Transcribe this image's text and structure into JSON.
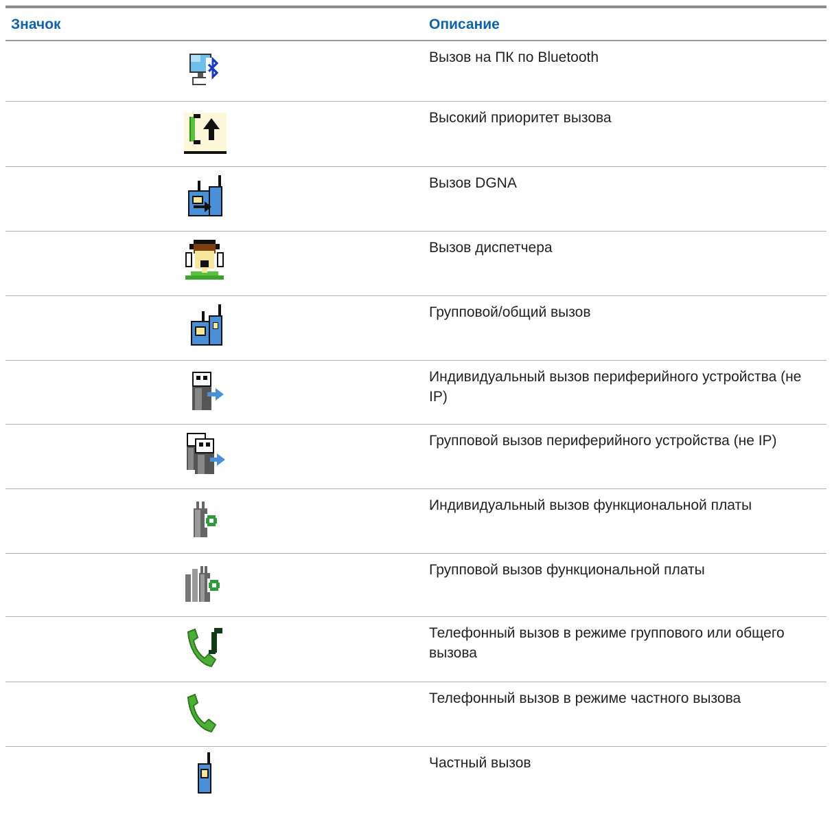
{
  "table": {
    "headers": {
      "icon": "Значок",
      "description": "Описание"
    },
    "rows": [
      {
        "icon": "pc-bluetooth-call-icon",
        "description": "Вызов на ПК по Bluetooth"
      },
      {
        "icon": "high-priority-call-icon",
        "description": "Высокий приоритет вызова"
      },
      {
        "icon": "dgna-call-icon",
        "description": "Вызов DGNA"
      },
      {
        "icon": "dispatcher-call-icon",
        "description": "Вызов диспетчера"
      },
      {
        "icon": "group-call-icon",
        "description": "Групповой/общий вызов"
      },
      {
        "icon": "peripheral-private-call-icon",
        "description": "Индивидуальный вызов периферийного устройства (не IP)"
      },
      {
        "icon": "peripheral-group-call-icon",
        "description": "Групповой вызов периферийного устройства (не IP)"
      },
      {
        "icon": "option-board-private-call-icon",
        "description": "Индивидуальный вызов функциональной платы"
      },
      {
        "icon": "option-board-group-call-icon",
        "description": "Групповой вызов функциональной платы"
      },
      {
        "icon": "phone-call-group-mode-icon",
        "description": "Телефонный вызов в режиме группового или общего вызова"
      },
      {
        "icon": "phone-call-private-mode-icon",
        "description": "Телефонный вызов в режиме частного вызова"
      },
      {
        "icon": "private-call-icon",
        "description": "Частный вызов"
      }
    ]
  },
  "colors": {
    "header_text": "#0d63ad",
    "radio_blue": "#4a90d9",
    "phone_green": "#4caf35",
    "grey": "#808080"
  }
}
